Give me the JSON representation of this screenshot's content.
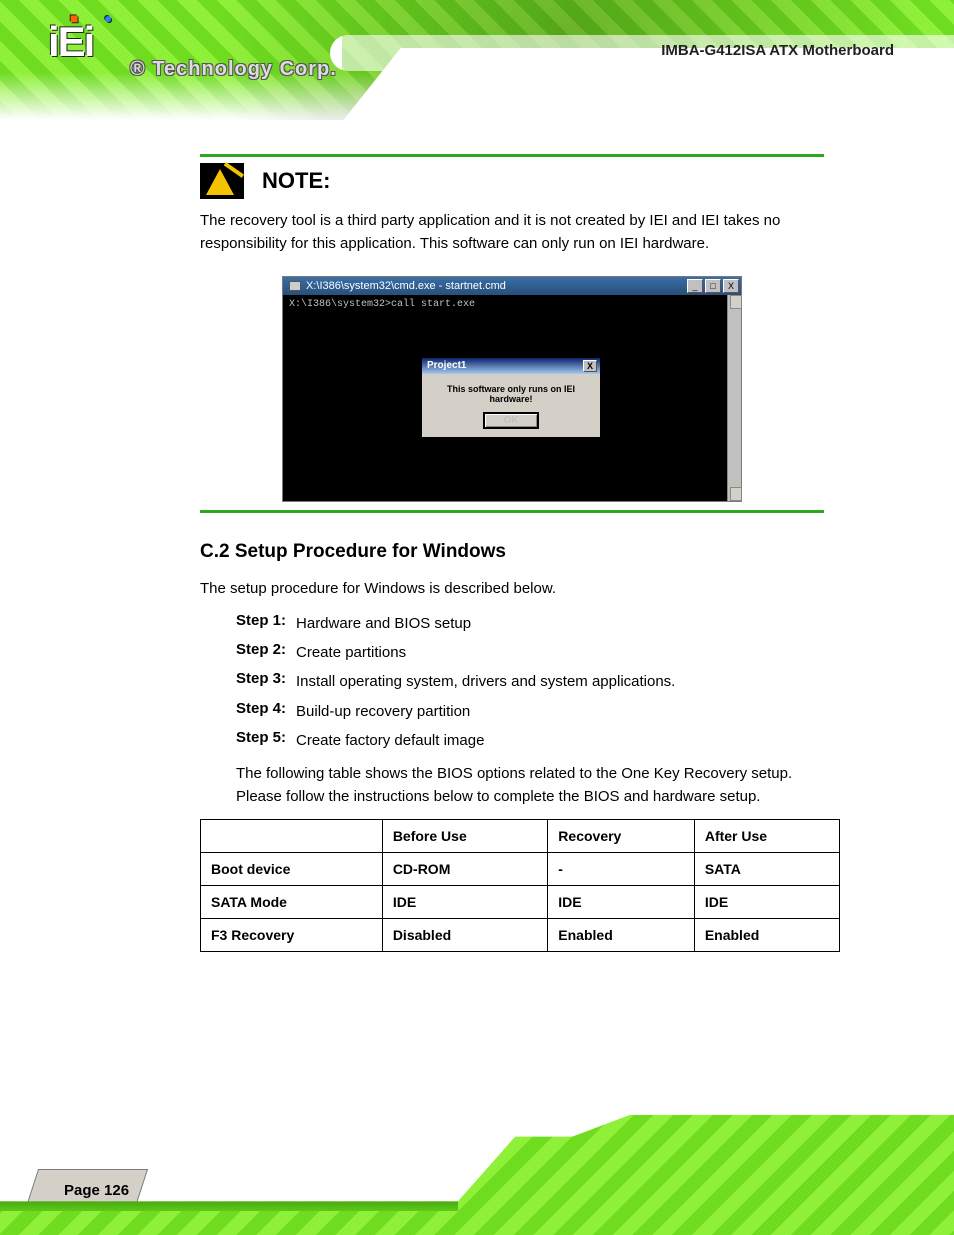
{
  "header": {
    "logo_text": "iEi",
    "logo_reg": "®",
    "brand_sub": "Technology Corp.",
    "product": "IMBA-G412ISA ATX Motherboard"
  },
  "note": {
    "title": "NOTE:",
    "body": "The recovery tool is a third party application and it is not created by IEI and IEI takes no responsibility for this application. This software can only run on IEI hardware."
  },
  "cmd": {
    "title": "X:\\I386\\system32\\cmd.exe - startnet.cmd",
    "prompt": "X:\\I386\\system32>call start.exe",
    "btn_min": "_",
    "btn_max": "□",
    "btn_close": "X"
  },
  "dialog": {
    "title": "Project1",
    "message": "This software only runs on IEI hardware!",
    "ok": "OK",
    "close": "X"
  },
  "section": {
    "heading": "C.2 Setup Procedure for Windows",
    "step1_label": "Step 1:",
    "step1_text": "Hardware and BIOS setup",
    "step2_label": "Step 2:",
    "step2_text": "Create partitions",
    "step3_label": "Step 3:",
    "step3_text": "Install operating system, drivers and system applications.",
    "step4_label": "Step 4:",
    "step4_text": "Build-up recovery partition",
    "step5_label": "Step 5:",
    "step5_text": "Create factory default image",
    "intro": "The setup procedure for Windows is described below.",
    "table_intro": "The following table shows the BIOS options related to the One Key Recovery setup. Please follow the instructions below to complete the BIOS and hardware setup."
  },
  "table": {
    "headers": [
      "",
      "Before Use",
      "Recovery",
      "After Use"
    ],
    "rows": [
      [
        "Boot device",
        "CD-ROM",
        "-",
        "SATA"
      ],
      [
        "SATA Mode",
        "IDE",
        "IDE",
        "IDE"
      ],
      [
        "F3 Recovery",
        "Disabled",
        "Enabled",
        "Enabled"
      ]
    ]
  },
  "footer": {
    "page": "Page 126"
  }
}
